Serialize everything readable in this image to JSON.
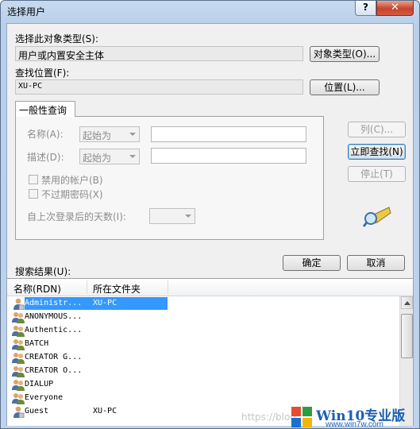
{
  "window": {
    "title": "选择用户",
    "help_glyph": "?",
    "close_glyph": "✕"
  },
  "object_type": {
    "label": "选择此对象类型(S):",
    "value": "用户或内置安全主体",
    "button": "对象类型(O)..."
  },
  "location": {
    "label": "查找位置(F):",
    "value": "XU-PC",
    "button": "位置(L)..."
  },
  "general_query": {
    "tab_label": "一般性查询",
    "name_label": "名称(A):",
    "name_mode": "起始为",
    "desc_label": "描述(D):",
    "desc_mode": "起始为",
    "disabled_accounts_label": "禁用的帐户(B)",
    "non_expiring_pw_label": "不过期密码(X)",
    "days_since_login_label": "自上次登录后的天数(I):"
  },
  "actions": {
    "columns_button": "列(C)...",
    "find_now_button": "立即查找(N)",
    "stop_button": "停止(T)",
    "ok_button": "确定",
    "cancel_button": "取消"
  },
  "results": {
    "label": "搜索结果(U):",
    "columns": [
      "名称(RDN)",
      "所在文件夹"
    ],
    "rows": [
      {
        "name": "Administr...",
        "folder": "XU-PC",
        "icon": "single-user-icon",
        "selected": true
      },
      {
        "name": "ANONYMOUS...",
        "folder": "",
        "icon": "group-icon",
        "selected": false
      },
      {
        "name": "Authentic...",
        "folder": "",
        "icon": "group-icon",
        "selected": false
      },
      {
        "name": "BATCH",
        "folder": "",
        "icon": "group-icon",
        "selected": false
      },
      {
        "name": "CREATOR G...",
        "folder": "",
        "icon": "group-icon",
        "selected": false
      },
      {
        "name": "CREATOR O...",
        "folder": "",
        "icon": "group-icon",
        "selected": false
      },
      {
        "name": "DIALUP",
        "folder": "",
        "icon": "group-icon",
        "selected": false
      },
      {
        "name": "Everyone",
        "folder": "",
        "icon": "group-icon",
        "selected": false
      },
      {
        "name": "Guest",
        "folder": "XU-PC",
        "icon": "single-user-icon",
        "selected": false
      }
    ]
  },
  "watermark": {
    "url": "https://blog",
    "brand": "Win10专业版",
    "site": "www.win7w.com"
  },
  "colors": {
    "selection": "#3399ff",
    "title_gradient": "#c7daef",
    "close_red": "#c8432c",
    "brand_blue": "#1a5fb4"
  }
}
